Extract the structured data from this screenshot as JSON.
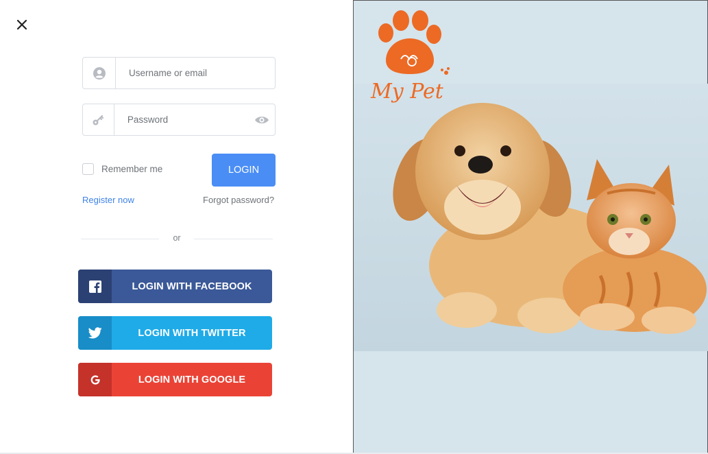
{
  "login_form": {
    "username_placeholder": "Username or email",
    "password_placeholder": "Password",
    "remember_label": "Remember me",
    "login_label": "LOGIN",
    "register_label": "Register now",
    "forgot_label": "Forgot password?",
    "or_label": "or"
  },
  "social": {
    "facebook_label": "LOGIN WITH FACEBOOK",
    "twitter_label": "LOGIN WITH TWITTER",
    "google_label": "LOGIN WITH GOOGLE"
  },
  "branding": {
    "logo_text": "My Pet"
  },
  "colors": {
    "login_button": "#4a8ef5",
    "facebook": "#3b5998",
    "twitter": "#1fabe8",
    "google": "#ea4336",
    "logo": "#ec6a24",
    "right_panel_bg": "#d6e4ec"
  },
  "icons": [
    "close-icon",
    "user-icon",
    "key-icon",
    "eye-icon",
    "facebook-icon",
    "twitter-icon",
    "google-icon",
    "paw-logo-icon"
  ]
}
